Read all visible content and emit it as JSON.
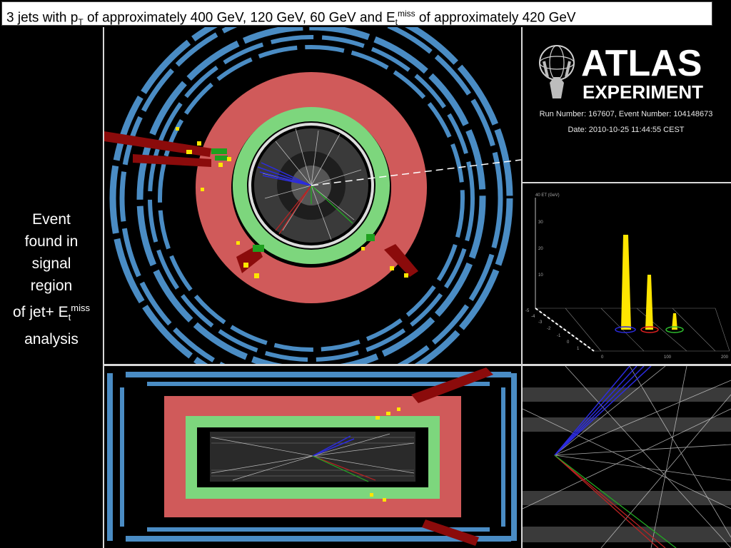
{
  "title": {
    "part1": "3 jets with p",
    "pt_sub": "T",
    "part2": " of approximately 400 GeV, 120 GeV, 60 GeV and E",
    "et_sub": "t",
    "et_sup": "miss",
    "part3": " of approximately 420 GeV"
  },
  "side": {
    "line1": "Event",
    "line2": "found in",
    "line3": "signal",
    "line4": "region",
    "line5_pre": "of jet+ E",
    "line5_sub": "t",
    "line5_sup": "miss",
    "line6": "analysis"
  },
  "logo": {
    "word1": "ATLAS",
    "word2": "EXPERIMENT"
  },
  "info": {
    "run_line": "Run Number: 167607, Event Number: 104148673",
    "date_line": "Date: 2010-10-25 11:44:55 CEST"
  },
  "lego": {
    "axis_title": "40 ET (GeV)",
    "y_ticks": [
      "30",
      "20",
      "10"
    ],
    "x_ticks": [
      "0",
      "100",
      "200"
    ],
    "eta_ticks": [
      "-5",
      "-4",
      "-3",
      "-2",
      "-1",
      "0",
      "1"
    ]
  },
  "colors": {
    "calorimeter_red": "#d05a5a",
    "calorimeter_green": "#7dd67d",
    "muon_blue": "#4a8cc4",
    "jet_dark_red": "#8b0b0b",
    "track_blue": "#2b2bdf",
    "deposit_yellow": "#ffe500"
  }
}
